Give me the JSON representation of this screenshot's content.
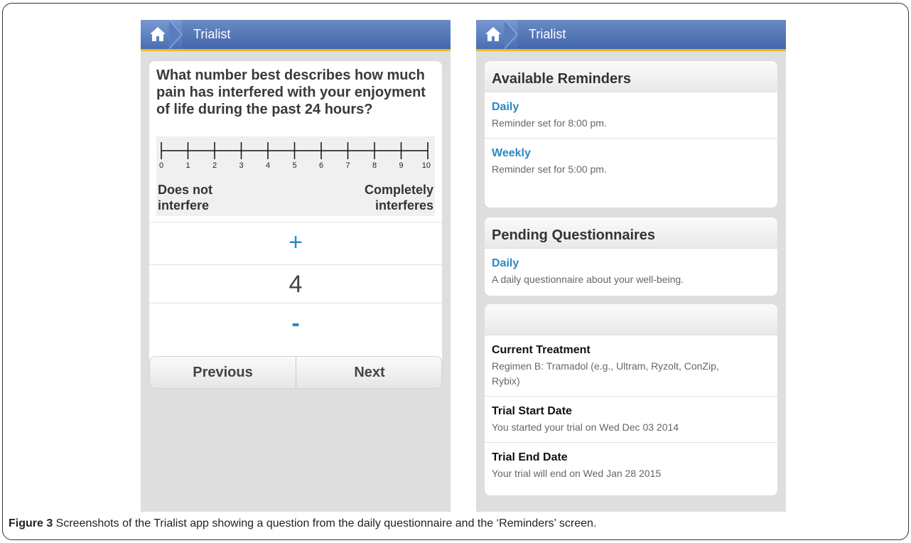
{
  "app": {
    "title": "Trialist"
  },
  "question_screen": {
    "question": "What number best describes how much pain has interfered with your enjoyment of life during the past 24 hours?",
    "scale": {
      "min": 0,
      "max": 10,
      "ticks": [
        "0",
        "1",
        "2",
        "3",
        "4",
        "5",
        "6",
        "7",
        "8",
        "9",
        "10"
      ],
      "anchor_low": "Does not interfere",
      "anchor_high": "Completely interferes"
    },
    "stepper": {
      "plus": "+",
      "value": "4",
      "minus": "-"
    },
    "buttons": {
      "previous": "Previous",
      "next": "Next"
    }
  },
  "reminders_screen": {
    "available_reminders": {
      "header": "Available Reminders",
      "items": [
        {
          "title": "Daily",
          "subtitle": "Reminder set for 8:00 pm."
        },
        {
          "title": "Weekly",
          "subtitle": "Reminder set for 5:00 pm."
        }
      ]
    },
    "pending_questionnaires": {
      "header": "Pending Questionnaires",
      "items": [
        {
          "title": "Daily",
          "subtitle": "A daily questionnaire about your well-being."
        }
      ]
    },
    "trial_info": {
      "items": [
        {
          "title": "Current Treatment",
          "subtitle": "Regimen B: Tramadol (e.g., Ultram, Ryzolt, ConZip, Rybix)"
        },
        {
          "title": "Trial Start Date",
          "subtitle": "You started your trial on Wed Dec 03 2014"
        },
        {
          "title": "Trial End Date",
          "subtitle": "Your trial will end on Wed Jan 28 2015"
        }
      ]
    }
  },
  "caption": {
    "label": "Figure 3",
    "text": " Screenshots of the Trialist app showing a question from the daily questionnaire and the ‘Reminders’ screen."
  },
  "colors": {
    "header_blue": "#4367ad",
    "accent_gold": "#f2b81b",
    "link_blue": "#2b89c4"
  }
}
